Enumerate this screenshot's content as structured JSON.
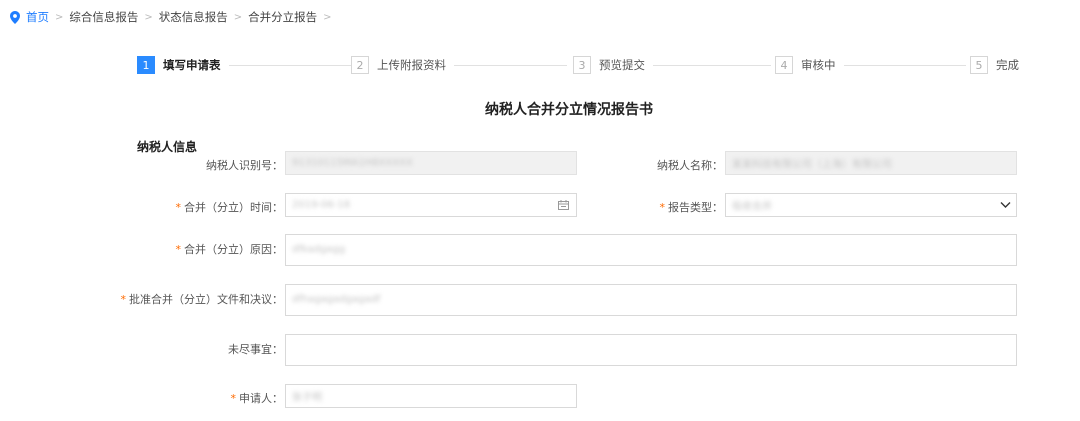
{
  "breadcrumb": {
    "items": [
      "首页",
      "综合信息报告",
      "状态信息报告",
      "合并分立报告"
    ],
    "separator": ">"
  },
  "steps": [
    {
      "num": "1",
      "label": "填写申请表",
      "active": true
    },
    {
      "num": "2",
      "label": "上传附报资料",
      "active": false
    },
    {
      "num": "3",
      "label": "预览提交",
      "active": false
    },
    {
      "num": "4",
      "label": "审核中",
      "active": false
    },
    {
      "num": "5",
      "label": "完成",
      "active": false
    }
  ],
  "form": {
    "title": "纳税人合并分立情况报告书",
    "section": "纳税人信息",
    "required_mark": "*",
    "fields": {
      "taxpayer_id": {
        "label": "纳税人识别号：",
        "value": "91310115MA1H8XXXXX"
      },
      "taxpayer_name": {
        "label": "纳税人名称：",
        "value": "某某科技有限公司（上海）有限公司"
      },
      "merge_time": {
        "label": "合并（分立）时间：",
        "value": "2019-06-18"
      },
      "report_type": {
        "label": "报告类型：",
        "value": "吸收合并"
      },
      "merge_reason": {
        "label": "合并（分立）原因：",
        "value": "dfkadgagg"
      },
      "approval_doc": {
        "label": "批准合并（分立）文件和决议：",
        "value": "dfhagagadgagadf"
      },
      "pending": {
        "label": "未尽事宜：",
        "value": ""
      },
      "applicant": {
        "label": "申请人：",
        "value": "张子明"
      }
    }
  },
  "colors": {
    "accent": "#2a8bff",
    "required": "#ff6a00",
    "breadcrumb_home": "#1e7dff"
  }
}
